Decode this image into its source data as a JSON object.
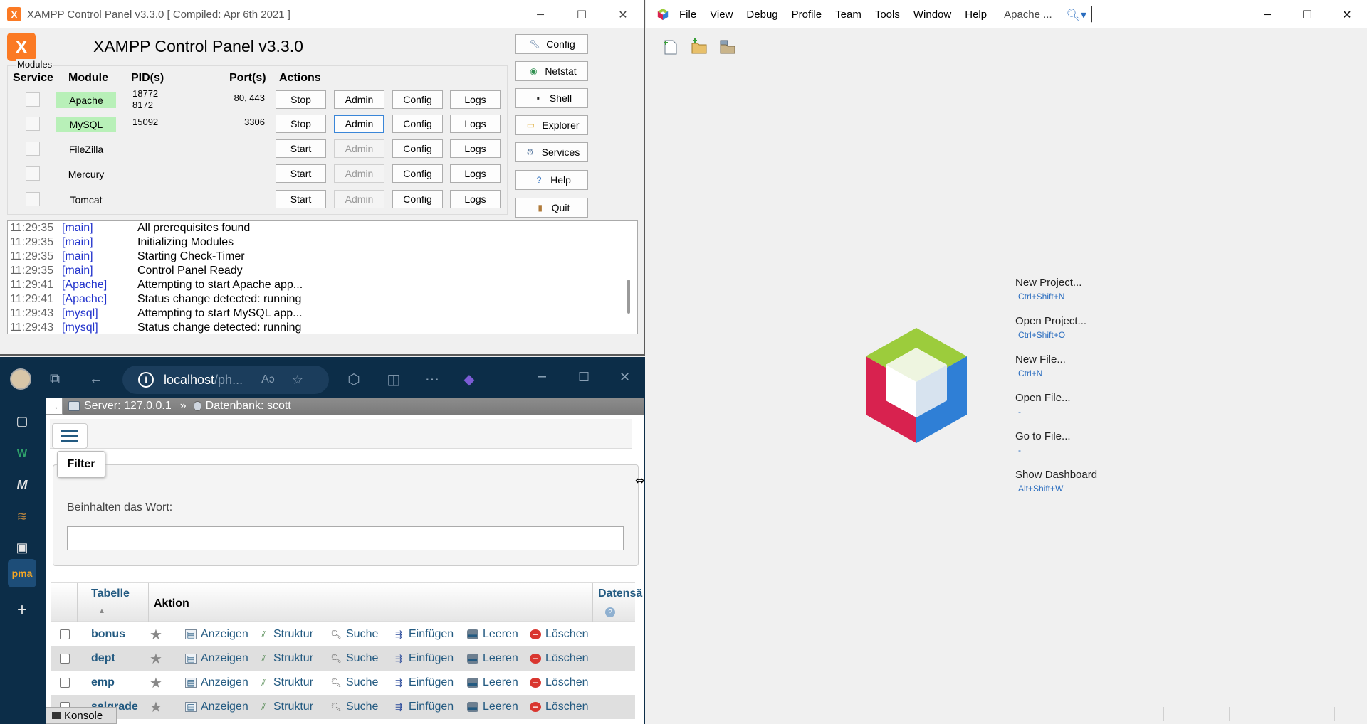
{
  "xampp": {
    "window_title": "XAMPP Control Panel v3.3.0   [ Compiled: Apr 6th 2021 ]",
    "heading": "XAMPP Control Panel v3.3.0",
    "modules_legend": "Modules",
    "columns": {
      "service": "Service",
      "module": "Module",
      "pids": "PID(s)",
      "ports": "Port(s)",
      "actions": "Actions"
    },
    "rows": [
      {
        "module": "Apache",
        "running": true,
        "pid1": "18772",
        "pid2": "8172",
        "port": "80, 443",
        "start_stop": "Stop",
        "admin": "Admin",
        "config": "Config",
        "logs": "Logs"
      },
      {
        "module": "MySQL",
        "running": true,
        "pid1": "15092",
        "pid2": "",
        "port": "3306",
        "start_stop": "Stop",
        "admin": "Admin",
        "config": "Config",
        "logs": "Logs"
      },
      {
        "module": "FileZilla",
        "running": false,
        "pid1": "",
        "pid2": "",
        "port": "",
        "start_stop": "Start",
        "admin": "Admin",
        "config": "Config",
        "logs": "Logs"
      },
      {
        "module": "Mercury",
        "running": false,
        "pid1": "",
        "pid2": "",
        "port": "",
        "start_stop": "Start",
        "admin": "Admin",
        "config": "Config",
        "logs": "Logs"
      },
      {
        "module": "Tomcat",
        "running": false,
        "pid1": "",
        "pid2": "",
        "port": "",
        "start_stop": "Start",
        "admin": "Admin",
        "config": "Config",
        "logs": "Logs"
      }
    ],
    "side_buttons": [
      {
        "label": "Config",
        "icon": "wrench-icon"
      },
      {
        "label": "Netstat",
        "icon": "globe-icon"
      },
      {
        "label": "Shell",
        "icon": "terminal-icon"
      },
      {
        "label": "Explorer",
        "icon": "folder-icon"
      },
      {
        "label": "Services",
        "icon": "services-icon"
      },
      {
        "label": "Help",
        "icon": "help-icon"
      },
      {
        "label": "Quit",
        "icon": "door-icon"
      }
    ],
    "log": [
      {
        "time": "11:29:35",
        "module": "[main]",
        "message": "All prerequisites found"
      },
      {
        "time": "11:29:35",
        "module": "[main]",
        "message": "Initializing Modules"
      },
      {
        "time": "11:29:35",
        "module": "[main]",
        "message": "Starting Check-Timer"
      },
      {
        "time": "11:29:35",
        "module": "[main]",
        "message": "Control Panel Ready"
      },
      {
        "time": "11:29:41",
        "module": "[Apache]",
        "message": "Attempting to start Apache app..."
      },
      {
        "time": "11:29:41",
        "module": "[Apache]",
        "message": "Status change detected: running"
      },
      {
        "time": "11:29:43",
        "module": "[mysql]",
        "message": "Attempting to start MySQL app..."
      },
      {
        "time": "11:29:43",
        "module": "[mysql]",
        "message": "Status change detected: running"
      }
    ],
    "colors": {
      "running": "#b8f0b8",
      "log_module": "#2233cc",
      "accent": "#fb7a24"
    }
  },
  "browser": {
    "url_host": "localhost",
    "url_rest": "/ph...",
    "breadcrumb": {
      "server": "Server: 127.0.0.1",
      "separator": "»",
      "database": "Datenbank: scott"
    },
    "filter": {
      "legend": "Filter",
      "label": "Beinhalten das Wort:",
      "value": ""
    },
    "table": {
      "headers": {
        "tabelle": "Tabelle",
        "aktion": "Aktion",
        "datensaetze": "Datensä"
      },
      "rows": [
        {
          "name": "bonus"
        },
        {
          "name": "dept"
        },
        {
          "name": "emp"
        },
        {
          "name": "salgrade"
        }
      ],
      "actions": [
        "Anzeigen",
        "Struktur",
        "Suche",
        "Einfügen",
        "Leeren",
        "Löschen"
      ]
    },
    "konsole": "Konsole",
    "colors": {
      "frame": "#0c2d48",
      "link": "#235a81",
      "row_alt": "#dfdfdf"
    }
  },
  "netbeans": {
    "menu": [
      "File",
      "View",
      "Debug",
      "Profile",
      "Team",
      "Tools",
      "Window",
      "Help"
    ],
    "project": "Apache ...",
    "search_value": "",
    "toolbar": [
      "new-file-icon",
      "new-project-icon",
      "open-project-icon"
    ],
    "welcome": [
      {
        "title": "New Project...",
        "shortcut": "Ctrl+Shift+N"
      },
      {
        "title": "Open Project...",
        "shortcut": "Ctrl+Shift+O"
      },
      {
        "title": "New File...",
        "shortcut": "Ctrl+N"
      },
      {
        "title": "Open File...",
        "shortcut": "-"
      },
      {
        "title": "Go to File...",
        "shortcut": "-"
      },
      {
        "title": "Show Dashboard",
        "shortcut": "Alt+Shift+W"
      }
    ],
    "colors": {
      "shortcut": "#2a6dbf",
      "cube_top": "#9ccc3c",
      "cube_left": "#d8224f",
      "cube_right": "#2f7fd6"
    }
  }
}
